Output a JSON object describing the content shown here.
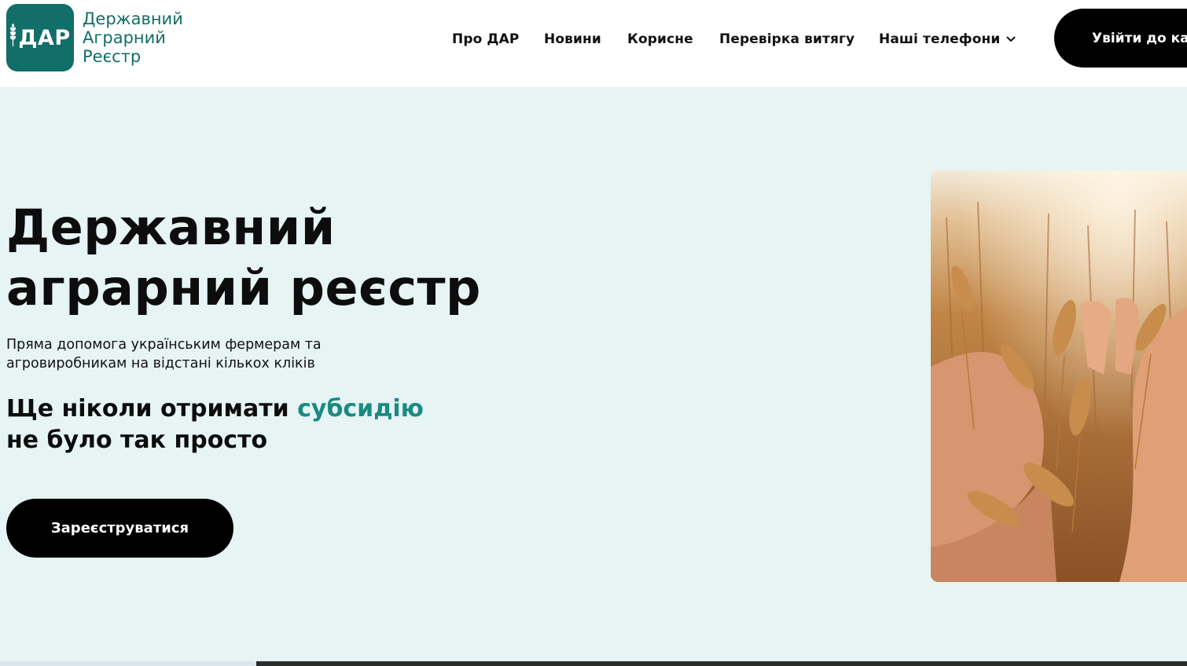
{
  "header": {
    "logo": {
      "badge_text": "ДАР",
      "name_lines": [
        "Державний",
        "Аграрний",
        "Реєстр"
      ],
      "brand_color": "#126e68",
      "icon": "wheat-icon"
    },
    "nav": {
      "items": [
        {
          "label": "Про ДАР"
        },
        {
          "label": "Новини"
        },
        {
          "label": "Корисне"
        },
        {
          "label": "Перевірка витягу"
        },
        {
          "label": "Наші телефони",
          "icon": "chevron-down-icon"
        }
      ]
    },
    "login_label": "Увійти до кабінету"
  },
  "hero": {
    "title_lines": [
      "Державний",
      "аграрний реєстр"
    ],
    "subtitle": "Пряма допомога українським фермерам та агровиробникам на відстані кількох кліків",
    "slogan": {
      "before": "Ще ніколи отримати",
      "accent": "субсидію",
      "after": "не було так просто"
    },
    "accent_color": "#1b8a82",
    "background_color": "#e6f4f3",
    "register_label": "Зареєструватися",
    "image": "wheat-field-hands-photo"
  }
}
